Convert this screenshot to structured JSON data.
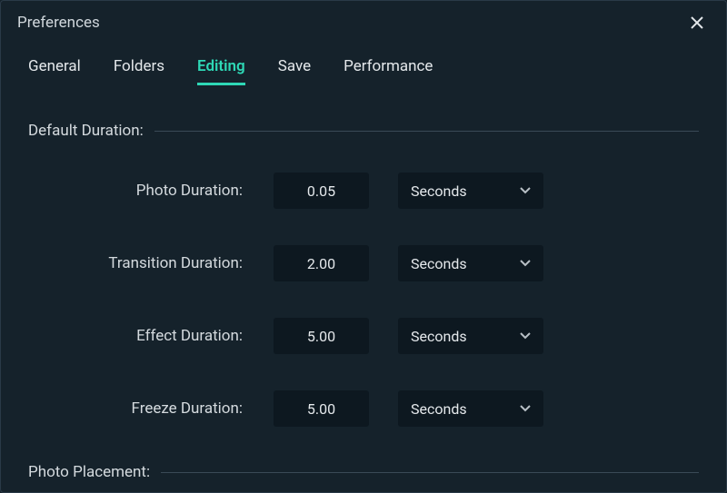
{
  "header": {
    "title": "Preferences"
  },
  "tabs": {
    "general": "General",
    "folders": "Folders",
    "editing": "Editing",
    "save": "Save",
    "performance": "Performance",
    "active": "editing"
  },
  "sections": {
    "default_duration": {
      "title": "Default Duration:",
      "rows": {
        "photo": {
          "label": "Photo Duration:",
          "value": "0.05",
          "unit": "Seconds"
        },
        "transition": {
          "label": "Transition Duration:",
          "value": "2.00",
          "unit": "Seconds"
        },
        "effect": {
          "label": "Effect Duration:",
          "value": "5.00",
          "unit": "Seconds"
        },
        "freeze": {
          "label": "Freeze Duration:",
          "value": "5.00",
          "unit": "Seconds"
        }
      }
    },
    "photo_placement": {
      "title": "Photo Placement:"
    }
  }
}
